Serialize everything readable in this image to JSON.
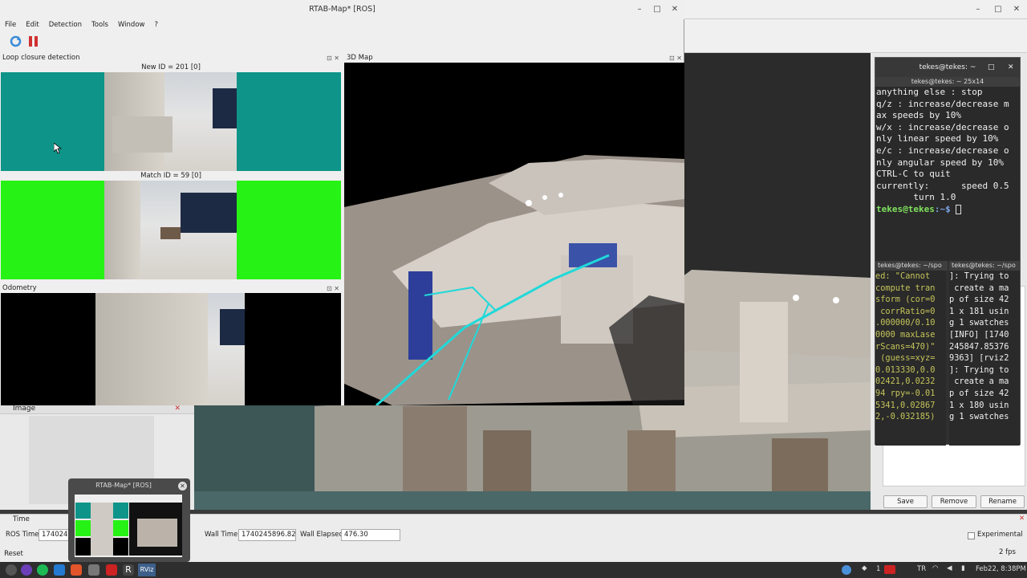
{
  "rtab": {
    "title": "RTAB-Map* [ROS]",
    "menu": [
      "File",
      "Edit",
      "Detection",
      "Tools",
      "Window",
      "?"
    ],
    "loop_panel_title": "Loop closure detection",
    "new_id": "New ID = 201 [0]",
    "match_id": "Match ID = 59 [0]",
    "odometry_title": "Odometry",
    "map_title": "3D Map"
  },
  "rviz": {
    "image_panel": "Image",
    "time_panel": "Time",
    "ros_time_label": "ROS Time:",
    "ros_time_value": "1740245",
    "wall_time_label": "Wall Time:",
    "wall_time_value": "1740245896.82",
    "wall_elapsed_label": "Wall Elapsed:",
    "wall_elapsed_value": "476.30",
    "experimental_label": "Experimental",
    "reset_label": "Reset",
    "fps": "2 fps",
    "save": "Save",
    "remove": "Remove",
    "rename": "Rename"
  },
  "preview": {
    "title": "RTAB-Map* [ROS]"
  },
  "term1": {
    "window_title": "tekes@tekes: ~",
    "tab_title": "tekes@tekes: ~ 25x14",
    "lines": [
      "anything else : stop",
      "",
      "q/z : increase/decrease m",
      "ax speeds by 10%",
      "w/x : increase/decrease o",
      "nly linear speed by 10%",
      "e/c : increase/decrease o",
      "nly angular speed by 10%",
      "",
      "CTRL-C to quit",
      "",
      "currently:      speed 0.5",
      "       turn 1.0"
    ],
    "prompt_user": "tekes@tekes",
    "prompt_path": ":~$ "
  },
  "term2": {
    "tab_title": "tekes@tekes: ~/spo",
    "lines": [
      "ed: \"Cannot",
      "compute tran",
      "sform (cor=0",
      " corrRatio=0",
      ".000000/0.10",
      "0000 maxLase",
      "rScans=470)\"",
      " (guess=xyz=",
      "0.013330,0.0",
      "02421,0.0232",
      "94 rpy=-0.01",
      "5341,0.02867",
      "2,-0.032185)"
    ]
  },
  "term3": {
    "tab_title": "tekes@tekes: ~/spo",
    "lines": [
      "]: Trying to",
      " create a ma",
      "p of size 42",
      "1 x 181 usin",
      "g 1 swatches",
      "[INFO] [1740",
      "245847.85376",
      "9363] [rviz2",
      "]: Trying to",
      " create a ma",
      "p of size 42",
      "1 x 180 usin",
      "g 1 swatches"
    ]
  },
  "taskbar": {
    "keyboard": "TR",
    "notif_count": "1",
    "clock": "Feb22,  8:38PM",
    "rviz_label": "RViz"
  },
  "colors": {
    "teal": "#0e9488",
    "green": "#27f215",
    "terminal_bg": "#2a2a2a",
    "prompt": "#7ee05c"
  }
}
